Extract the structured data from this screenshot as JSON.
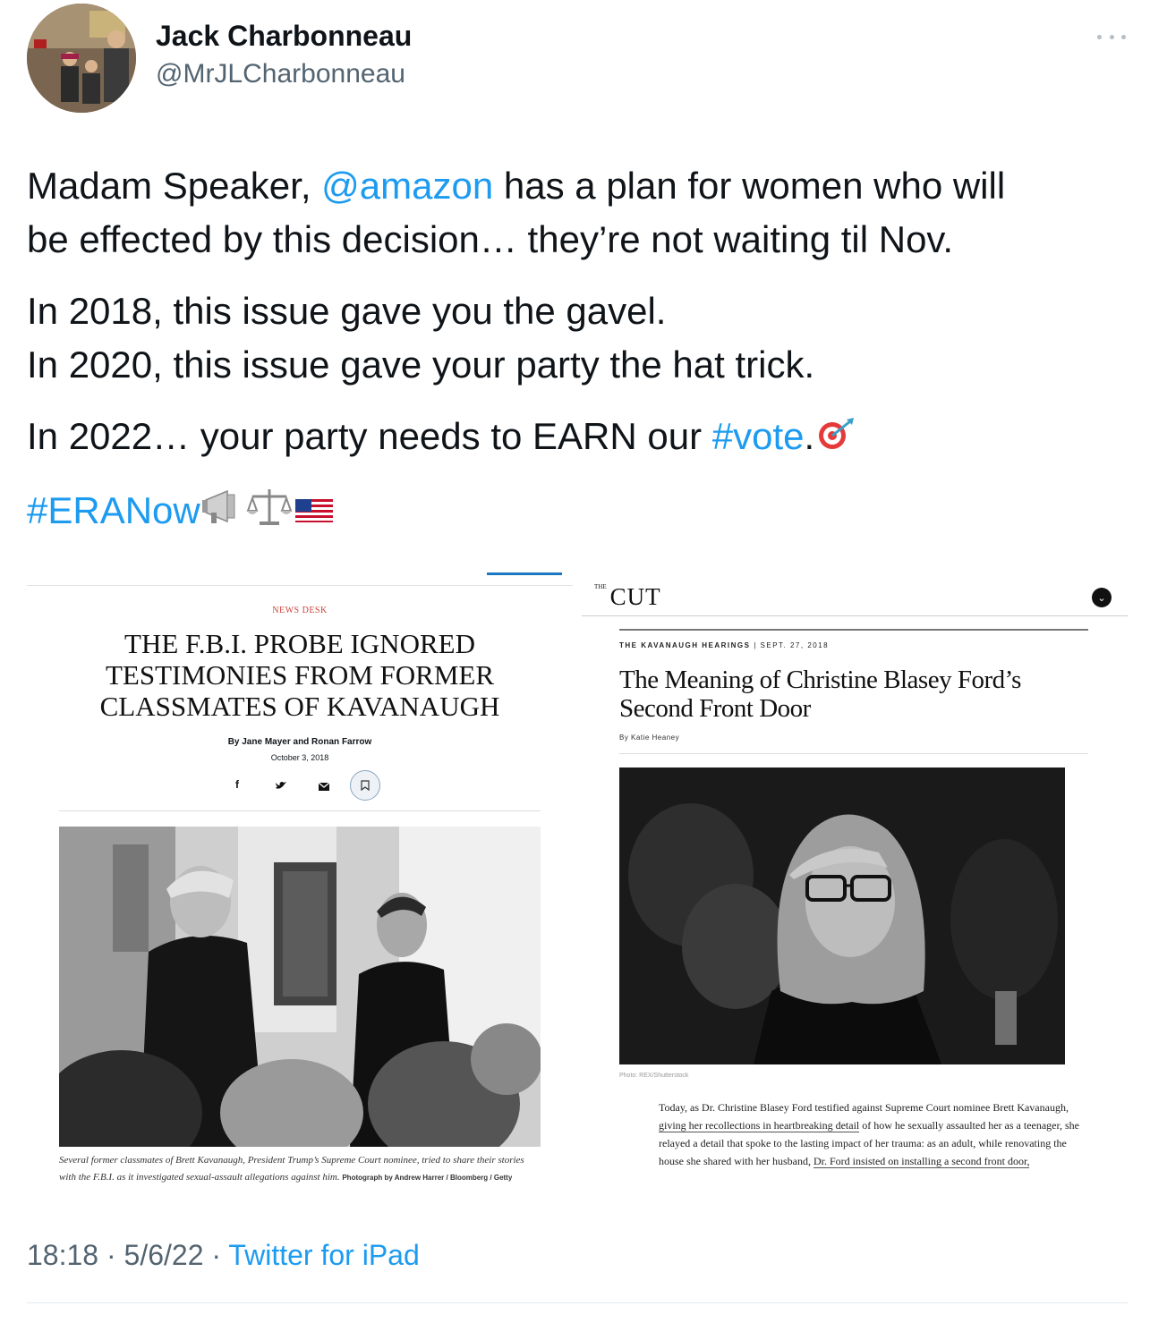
{
  "user": {
    "display_name": "Jack Charbonneau",
    "handle": "@MrJLCharbonneau"
  },
  "tweet": {
    "line1_a": "Madam Speaker, ",
    "mention": "@amazon",
    "line1_b": " has a plan for women who will",
    "line2": "be effected by this decision… they’re not waiting til Nov.",
    "line3": "In 2018, this issue gave you the gavel.",
    "line4": "In 2020, this issue gave your party the hat trick.",
    "line5_a": "In 2022… your party needs to EARN our ",
    "hashtag_vote": "#vote",
    "line5_b": ".",
    "hashtag_era": "#ERANow",
    "emojis": [
      "megaphone-icon",
      "scales-icon",
      "us-flag-icon",
      "direct-hit-icon"
    ]
  },
  "article_left": {
    "kicker": "NEWS DESK",
    "headline": "THE F.B.I. PROBE IGNORED TESTIMONIES FROM FORMER CLASSMATES OF KAVANAUGH",
    "byline": "By Jane Mayer and Ronan Farrow",
    "date": "October 3, 2018",
    "share_icons": [
      "facebook-icon",
      "twitter-icon",
      "email-icon",
      "bookmark-icon"
    ],
    "share_facebook": "f",
    "caption": "Several former classmates of Brett Kavanaugh, President Trump’s Supreme Court nominee, tried to share their stories with the F.B.I. as it investigated sexual-assault allegations against him.",
    "credit": "Photograph by Andrew Harrer / Bloomberg / Getty"
  },
  "article_right": {
    "logo_the": "THE",
    "logo": "CUT",
    "kicker": "THE KAVANAUGH HEARINGS",
    "sep": "|",
    "date": "SEPT. 27, 2018",
    "headline_l1": "The Meaning of Christine Blasey Ford’s",
    "headline_l2": "Second Front Door",
    "byline": "By Katie Heaney",
    "photo_credit": "Photo: REX/Shutterstock",
    "body_a": "Today, as Dr. Christine Blasey Ford testified against Supreme Court nominee Brett Kavanaugh, ",
    "body_link1": "giving her recollections in heartbreaking detail",
    "body_b": " of how he sexually assaulted her as a teenager, she relayed a detail that spoke to the lasting impact of her trauma: as an adult, while renovating the house she shared with her husband, ",
    "body_link2": "Dr. Ford insisted on installing a second front door,"
  },
  "footer": {
    "time": "18:18",
    "dot1": " · ",
    "date": "5/6/22",
    "dot2": " · ",
    "source": "Twitter for iPad"
  },
  "colors": {
    "link": "#1d9bf0",
    "secondary_text": "#536471",
    "kicker_red": "#d0413a"
  }
}
